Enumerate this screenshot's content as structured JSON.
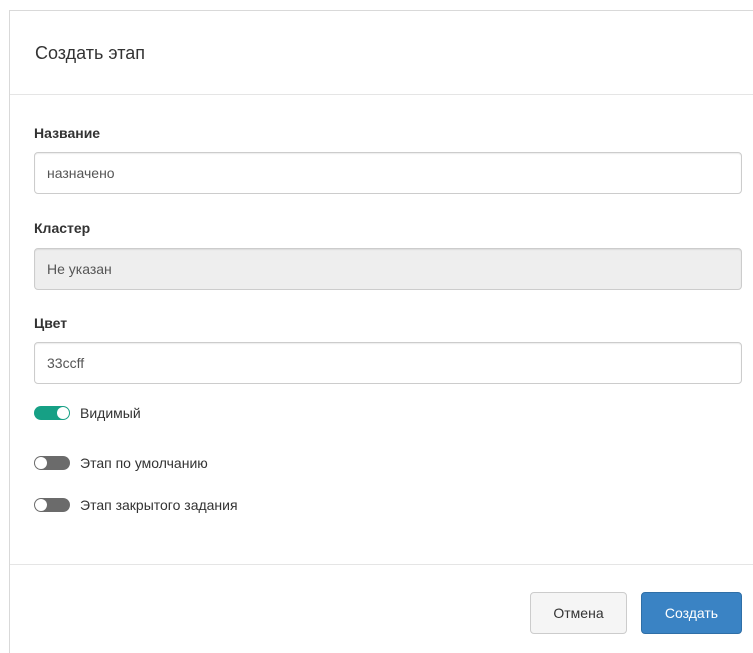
{
  "dialog": {
    "title": "Создать этап"
  },
  "fields": {
    "name": {
      "label": "Название",
      "value": "назначено"
    },
    "cluster": {
      "label": "Кластер",
      "value": "Не указан"
    },
    "color": {
      "label": "Цвет",
      "value": "33ccff"
    }
  },
  "toggles": [
    {
      "label": "Видимый",
      "on": true
    },
    {
      "label": "Этап по умолчанию",
      "on": false
    },
    {
      "label": "Этап закрытого задания",
      "on": false
    }
  ],
  "footer": {
    "cancel_label": "Отмена",
    "create_label": "Создать"
  },
  "colors": {
    "toggle_on": "#16a085",
    "toggle_off": "#6b6b6b",
    "primary_button": "#3a83c4"
  }
}
